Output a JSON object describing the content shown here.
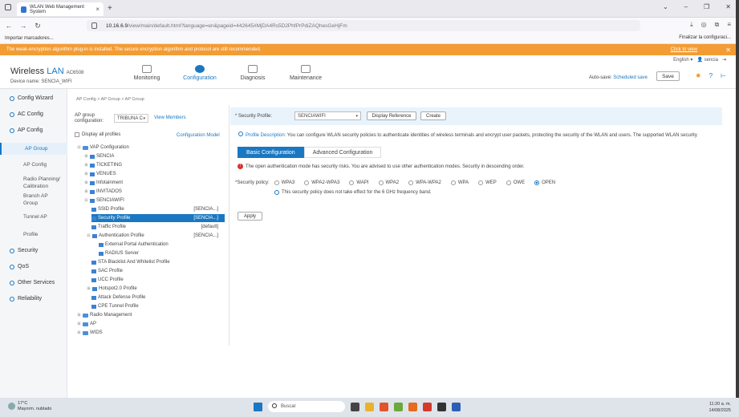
{
  "browser": {
    "tab_title": "WLAN Web Management System",
    "url_host": "10.16.6.9",
    "url_path": "/view/main/default.html?language=en&pageid=442645#MjDA4Rs5D2PhfPrPdiZAQhesGeHjFm",
    "bookmark_left": "Importar marcadores...",
    "bookmark_right": "Finalizar la configuraci..."
  },
  "warning_bar": {
    "text": "The weak-encryption algorithm plug-in is installed. The secure encryption algorithm and protocol are still recommended.",
    "link": "Click to view",
    "color": "#f39c33"
  },
  "header": {
    "brand_wireless": "Wireless",
    "brand_lan": "LAN",
    "model": "AC6508",
    "device_label": "Device name:",
    "device_name": "SENCIA_WIFI",
    "language": "English",
    "user": "sencia",
    "menu": [
      {
        "label": "Monitoring"
      },
      {
        "label": "Configuration"
      },
      {
        "label": "Diagnosis"
      },
      {
        "label": "Maintenance"
      }
    ],
    "autosave_label": "Auto-save:",
    "autosave_value": "Scheduled save",
    "save_label": "Save",
    "accent": "#1a78c2"
  },
  "sidebar": {
    "items": [
      {
        "label": "Config Wizard"
      },
      {
        "label": "AC Config"
      },
      {
        "label": "AP Config"
      },
      {
        "label": "Security"
      },
      {
        "label": "QoS"
      },
      {
        "label": "Other Services"
      },
      {
        "label": "Reliability"
      }
    ],
    "sub": [
      {
        "label": "AP Group"
      },
      {
        "label": "AP Config"
      },
      {
        "label": "Radio Planning/ Calibration"
      },
      {
        "label": "Branch AP Group"
      },
      {
        "label": "Tunnel AP"
      },
      {
        "label": "Profile"
      }
    ]
  },
  "main": {
    "breadcrumb": "AP Config > AP Group > AP Group",
    "group_conf_label": "AP group configuration:",
    "group_value": "TRIBUNA C",
    "view_members": "View Members",
    "display_all": "Display all profiles",
    "config_model": "Configuration Model",
    "tree": [
      {
        "label": "VAP Configuration",
        "value": ""
      },
      {
        "label": "SENCIA",
        "value": ""
      },
      {
        "label": "TICKETING",
        "value": ""
      },
      {
        "label": "VENUES",
        "value": ""
      },
      {
        "label": "Infotainment",
        "value": ""
      },
      {
        "label": "INVITADOS",
        "value": ""
      },
      {
        "label": "SENCIAWIFI",
        "value": ""
      },
      {
        "label": "SSID Profile",
        "value": "[SENCIA...]"
      },
      {
        "label": "Security Profile",
        "value": "[SENCIA...]"
      },
      {
        "label": "Traffic Profile",
        "value": "[default]"
      },
      {
        "label": "Authentication Profile",
        "value": "[SENCIA...]"
      },
      {
        "label": "External Portal Authentication",
        "value": ""
      },
      {
        "label": "RADIUS Server",
        "value": ""
      },
      {
        "label": "STA Blacklist And Whitelist Profile",
        "value": ""
      },
      {
        "label": "SAC Profile",
        "value": ""
      },
      {
        "label": "UCC Profile",
        "value": ""
      },
      {
        "label": "Hotspot2.0 Profile",
        "value": ""
      },
      {
        "label": "Attack Defense Profile",
        "value": ""
      },
      {
        "label": "CPE Tunnel Profile",
        "value": ""
      },
      {
        "label": "Radio Management",
        "value": ""
      },
      {
        "label": "AP",
        "value": ""
      },
      {
        "label": "WIDS",
        "value": ""
      }
    ],
    "profile_label": "Security Profile:",
    "profile_value": "SENCIAWIFI",
    "display_reference": "Display Reference",
    "create": "Create",
    "desc_label": "Profile Description:",
    "desc_text": "You can configure WLAN security policies to authenticate identities of wireless terminals and encrypt user packets, protecting the security of the WLAN and users. The supported WLAN security",
    "tab_basic": "Basic Configuration",
    "tab_advanced": "Advanced Configuration",
    "warning": "The open authentication mode has security risks. You are advised to use other authentication modes. Security in descending order.",
    "policy_label": "Security policy:",
    "policies": [
      {
        "label": "WPA3"
      },
      {
        "label": "WPA2-WPA3"
      },
      {
        "label": "WAPI"
      },
      {
        "label": "WPA2"
      },
      {
        "label": "WPA-WPA2"
      },
      {
        "label": "WPA"
      },
      {
        "label": "WEP"
      },
      {
        "label": "OWE"
      },
      {
        "label": "OPEN"
      }
    ],
    "selected_policy": "OPEN",
    "policy_note": "This security policy does not take effect for the 6 GHz frequency band.",
    "apply": "Apply"
  },
  "taskbar": {
    "temp": "17°C",
    "weather": "Mayorm. nublado",
    "search": "Buscar",
    "time": "11:20 a. m.",
    "date": "14/08/2025"
  }
}
